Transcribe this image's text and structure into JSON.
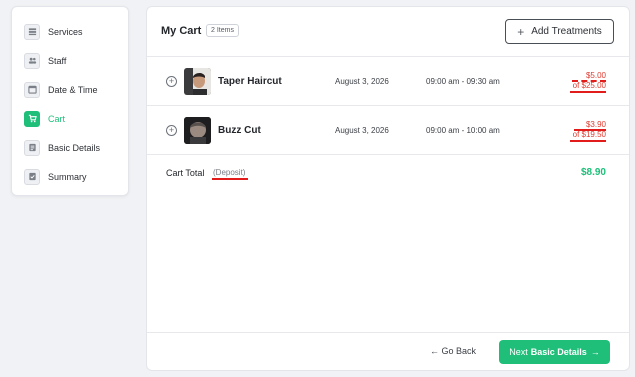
{
  "sidebar": {
    "items": [
      {
        "label": "Services",
        "icon": "list-icon"
      },
      {
        "label": "Staff",
        "icon": "users-icon"
      },
      {
        "label": "Date & Time",
        "icon": "calendar-icon"
      },
      {
        "label": "Cart",
        "icon": "cart-icon",
        "active": true
      },
      {
        "label": "Basic Details",
        "icon": "details-icon"
      },
      {
        "label": "Summary",
        "icon": "checklist-icon"
      }
    ]
  },
  "cart": {
    "title": "My Cart",
    "badge": "2 Items",
    "add_label": "Add Treatments",
    "items": [
      {
        "name": "Taper Haircut",
        "date": "August 3, 2026",
        "time": "09:00 am - 09:30 am",
        "deposit": "$5.00",
        "full": "of $25.00"
      },
      {
        "name": "Buzz Cut",
        "date": "August 3, 2026",
        "time": "09:00 am - 10:00 am",
        "deposit": "$3.90",
        "full": "of $19.50"
      }
    ],
    "total_label": "Cart Total",
    "total_note": "(Deposit)",
    "total_value": "$8.90"
  },
  "footer": {
    "back_label": "Go Back",
    "next_label_prefix": "Next",
    "next_label_bold": "Basic Details"
  },
  "colors": {
    "accent": "#1fbf7a",
    "annotation_red": "#e21b1b"
  }
}
